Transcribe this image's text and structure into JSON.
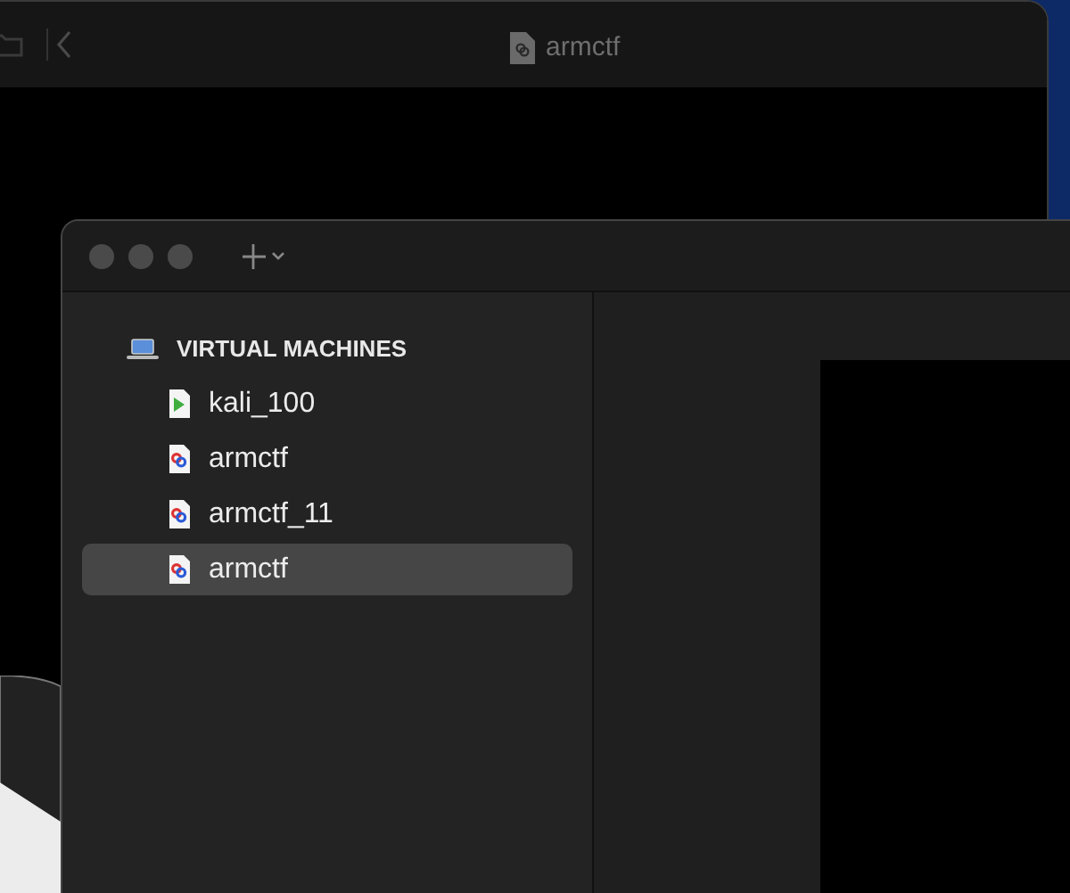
{
  "back_window": {
    "title": "armctf"
  },
  "front_window": {
    "sidebar": {
      "section": "VIRTUAL MACHINES",
      "items": [
        {
          "label": "kali_100",
          "kind": "running",
          "selected": false
        },
        {
          "label": "armctf",
          "kind": "vm",
          "selected": false
        },
        {
          "label": "armctf_11",
          "kind": "vm",
          "selected": false
        },
        {
          "label": "armctf",
          "kind": "vm",
          "selected": true
        }
      ]
    }
  }
}
